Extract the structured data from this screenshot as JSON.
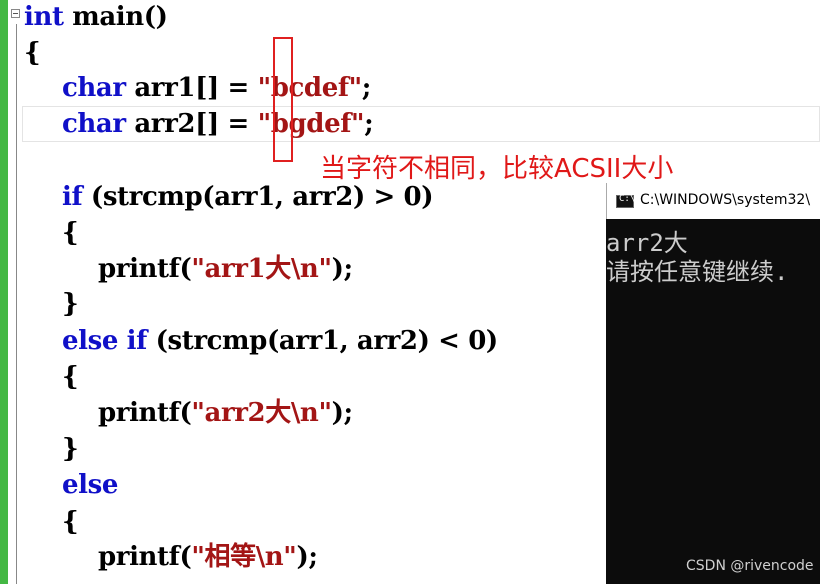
{
  "code": {
    "l1": {
      "kw": "int",
      "rest": " main()"
    },
    "l2": "{",
    "l3": {
      "kw": "char",
      "mid": " arr1[] = ",
      "str": "\"bcdef\"",
      "end": ";"
    },
    "l4": {
      "kw": "char",
      "mid": " arr2[] = ",
      "str": "\"bgdef\"",
      "end": ";"
    },
    "l5": {
      "kw": "if",
      "rest": " (strcmp(arr1, arr2) > 0)"
    },
    "l6": "{",
    "l7": {
      "pre": "printf(",
      "str": "\"arr1大\\n\"",
      "end": ");"
    },
    "l8": "}",
    "l9": {
      "kw": "else if",
      "rest": " (strcmp(arr1, arr2) < 0)"
    },
    "l10": "{",
    "l11": {
      "pre": "printf(",
      "str": "\"arr2大\\n\"",
      "end": ");"
    },
    "l12": "}",
    "l13": {
      "kw": "else"
    },
    "l14": "{",
    "l15": {
      "pre": "printf(",
      "str": "\"相等\\n\"",
      "end": ");"
    }
  },
  "annotation": "当字符不相同，比较ACSII大小",
  "console": {
    "title": "C:\\WINDOWS\\system32\\",
    "icon": "cmd-icon",
    "icon_text": "C:\\",
    "output": [
      "arr2大",
      "请按任意键继续."
    ]
  },
  "watermark": "CSDN @rivencode",
  "colors": {
    "keyword": "#1010c8",
    "string": "#a31515",
    "annotation": "#e01818",
    "gutter": "#44b844",
    "console_bg": "#0c0c0c"
  }
}
